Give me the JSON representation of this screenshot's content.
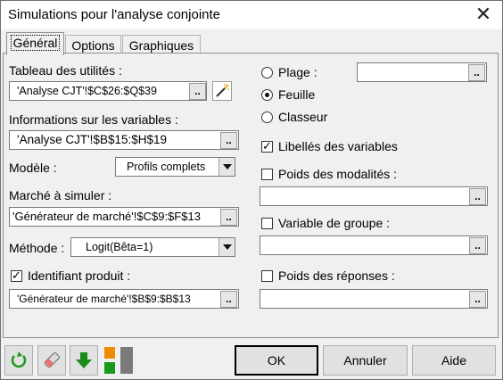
{
  "window": {
    "title": "Simulations pour l'analyse conjointe",
    "close_icon": "close-icon"
  },
  "tabs": [
    {
      "label": "Général"
    },
    {
      "label": "Options"
    },
    {
      "label": "Graphiques"
    }
  ],
  "general": {
    "utilities_label": "Tableau des utilités :",
    "utilities_value": "'Analyse CJT'!$C$26:$Q$39",
    "variables_label": "Informations sur les variables :",
    "variables_value": "'Analyse CJT'!$B$15:$H$19",
    "model_label": "Modèle :",
    "model_value": "Profils complets",
    "market_label": "Marché à simuler :",
    "market_value": "'Générateur de marché'!$C$9:$F$13",
    "method_label": "Méthode :",
    "method_value": "Logit(Bêta=1)",
    "product_id_label": "Identifiant produit :",
    "product_id_checked": true,
    "product_id_value": "'Générateur de marché'!$B$9:$B$13"
  },
  "output": {
    "range_label": "Plage :",
    "sheet_label": "Feuille",
    "workbook_label": "Classeur",
    "selected": "Feuille"
  },
  "right_options": {
    "variable_labels_label": "Libellés des variables",
    "variable_labels_checked": true,
    "modality_weights_label": "Poids des modalités :",
    "modality_weights_checked": false,
    "group_variable_label": "Variable de groupe :",
    "group_variable_checked": false,
    "response_weights_label": "Poids des réponses :",
    "response_weights_checked": false
  },
  "range_button_label": "..",
  "footer": {
    "ok_label": "OK",
    "cancel_label": "Annuler",
    "help_label": "Aide"
  },
  "colors": {
    "green_icon": "#1a9a1a",
    "orange_icon": "#f08a00",
    "gray_icon": "#7a7a7a"
  }
}
